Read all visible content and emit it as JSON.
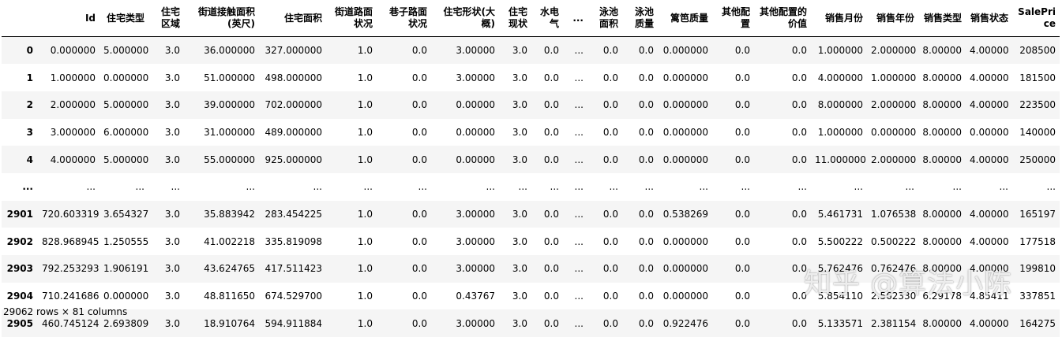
{
  "columns": [
    "",
    "Id",
    "住宅类型",
    "住宅区域",
    "街道接触面积(英尺)",
    "住宅面积",
    "街道路面状况",
    "巷子路面状况",
    "住宅形状(大概)",
    "住宅现状",
    "水电气",
    "...",
    "泳池面积",
    "泳池质量",
    "篱笆质量",
    "其他配置",
    "其他配置的价值",
    "销售月份",
    "销售年份",
    "销售类型",
    "销售状态",
    "SalePrice"
  ],
  "rows": [
    [
      "0",
      "0.000000",
      "5.000000",
      "3.0",
      "36.000000",
      "327.000000",
      "1.0",
      "0.0",
      "3.00000",
      "3.0",
      "0.0",
      "...",
      "0.0",
      "0.0",
      "0.000000",
      "0.0",
      "0.0",
      "1.000000",
      "2.000000",
      "8.00000",
      "4.00000",
      "208500"
    ],
    [
      "1",
      "1.000000",
      "0.000000",
      "3.0",
      "51.000000",
      "498.000000",
      "1.0",
      "0.0",
      "3.00000",
      "3.0",
      "0.0",
      "...",
      "0.0",
      "0.0",
      "0.000000",
      "0.0",
      "0.0",
      "4.000000",
      "1.000000",
      "8.00000",
      "4.00000",
      "181500"
    ],
    [
      "2",
      "2.000000",
      "5.000000",
      "3.0",
      "39.000000",
      "702.000000",
      "1.0",
      "0.0",
      "0.00000",
      "3.0",
      "0.0",
      "...",
      "0.0",
      "0.0",
      "0.000000",
      "0.0",
      "0.0",
      "8.000000",
      "2.000000",
      "8.00000",
      "4.00000",
      "223500"
    ],
    [
      "3",
      "3.000000",
      "6.000000",
      "3.0",
      "31.000000",
      "489.000000",
      "1.0",
      "0.0",
      "0.00000",
      "3.0",
      "0.0",
      "...",
      "0.0",
      "0.0",
      "0.000000",
      "0.0",
      "0.0",
      "1.000000",
      "0.000000",
      "8.00000",
      "0.00000",
      "140000"
    ],
    [
      "4",
      "4.000000",
      "5.000000",
      "3.0",
      "55.000000",
      "925.000000",
      "1.0",
      "0.0",
      "0.00000",
      "3.0",
      "0.0",
      "...",
      "0.0",
      "0.0",
      "0.000000",
      "0.0",
      "0.0",
      "11.000000",
      "2.000000",
      "8.00000",
      "4.00000",
      "250000"
    ],
    [
      "...",
      "...",
      "...",
      "...",
      "...",
      "...",
      "...",
      "...",
      "...",
      "...",
      "...",
      "...",
      "...",
      "...",
      "...",
      "...",
      "...",
      "...",
      "...",
      "...",
      "...",
      "..."
    ],
    [
      "2901",
      "720.603319",
      "3.654327",
      "3.0",
      "35.883942",
      "283.454225",
      "1.0",
      "0.0",
      "3.00000",
      "3.0",
      "0.0",
      "...",
      "0.0",
      "0.0",
      "0.538269",
      "0.0",
      "0.0",
      "5.461731",
      "1.076538",
      "8.00000",
      "4.00000",
      "165197"
    ],
    [
      "2902",
      "828.968945",
      "1.250555",
      "3.0",
      "41.002218",
      "335.819098",
      "1.0",
      "0.0",
      "3.00000",
      "3.0",
      "0.0",
      "...",
      "0.0",
      "0.0",
      "0.000000",
      "0.0",
      "0.0",
      "5.500222",
      "0.500222",
      "8.00000",
      "4.00000",
      "177518"
    ],
    [
      "2903",
      "792.253293",
      "1.906191",
      "3.0",
      "43.624765",
      "417.511423",
      "1.0",
      "0.0",
      "3.00000",
      "3.0",
      "0.0",
      "...",
      "0.0",
      "0.0",
      "0.000000",
      "0.0",
      "0.0",
      "5.762476",
      "0.762476",
      "8.00000",
      "4.00000",
      "199810"
    ],
    [
      "2904",
      "710.241686",
      "0.000000",
      "3.0",
      "48.811650",
      "674.529700",
      "1.0",
      "0.0",
      "0.43767",
      "3.0",
      "0.0",
      "...",
      "0.0",
      "0.0",
      "0.000000",
      "0.0",
      "0.0",
      "5.854110",
      "2.562330",
      "6.29178",
      "4.85411",
      "337851"
    ],
    [
      "2905",
      "460.745124",
      "2.693809",
      "3.0",
      "18.910764",
      "594.911884",
      "1.0",
      "0.0",
      "3.00000",
      "3.0",
      "0.0",
      "...",
      "0.0",
      "0.0",
      "0.922476",
      "0.0",
      "0.0",
      "5.133571",
      "2.381154",
      "8.00000",
      "4.00000",
      "164275"
    ]
  ],
  "footer": "29062 rows × 81 columns",
  "watermark": "知乎 @算法小陈"
}
